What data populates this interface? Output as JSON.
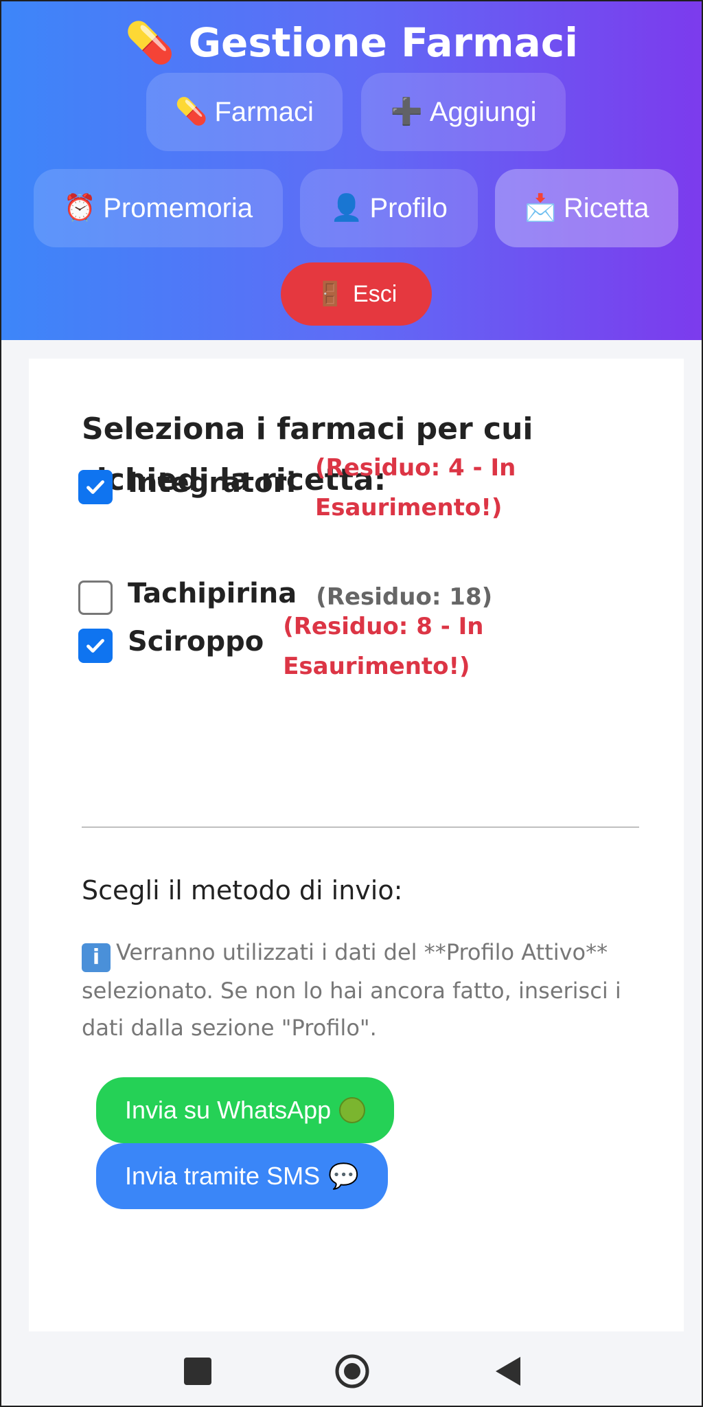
{
  "header": {
    "title_icon": "💊",
    "title": "Gestione Farmaci",
    "nav": [
      {
        "icon": "💊",
        "label": "Farmaci"
      },
      {
        "icon": "➕",
        "label": "Aggiungi"
      },
      {
        "icon": "⏰",
        "label": "Promemoria"
      },
      {
        "icon": "👤",
        "label": "Profilo"
      },
      {
        "icon": "📩",
        "label": "Ricetta"
      }
    ],
    "logout": {
      "icon": "🚪",
      "label": "Esci"
    }
  },
  "prescription": {
    "title": "Seleziona i farmaci per cui richiedi la ricetta:",
    "medicines": [
      {
        "name": "Integratori",
        "checked": true,
        "residue_line1": "(Residuo: 4 - In",
        "residue_line2": "Esaurimento!)"
      },
      {
        "name": "Tachipirina",
        "checked": false,
        "residue_line1": "(Residuo: 18)",
        "residue_line2": ""
      },
      {
        "name": "Sciroppo",
        "checked": true,
        "residue_line1": "(Residuo: 8 - In",
        "residue_line2": "Esaurimento!)"
      }
    ],
    "send_title": "Scegli il metodo di invio:",
    "info_icon": "ℹ️",
    "info_text": "Verranno utilizzati i dati del **Profilo Attivo** selezionato. Se non lo hai ancora fatto, inserisci i dati dalla sezione \"Profilo\".",
    "whatsapp_label": "Invia su WhatsApp",
    "sms_label": "Invia tramite SMS",
    "sms_icon": "💬"
  },
  "colors": {
    "header_start": "#3d86f9",
    "header_end": "#7c3bed",
    "logout": "#e5383f",
    "warning": "#dc3545",
    "checkbox": "#0f74f0",
    "whatsapp": "#25d156",
    "sms": "#3a86f8"
  },
  "system_nav": [
    "square-recents-icon",
    "circle-home-icon",
    "triangle-back-icon"
  ]
}
